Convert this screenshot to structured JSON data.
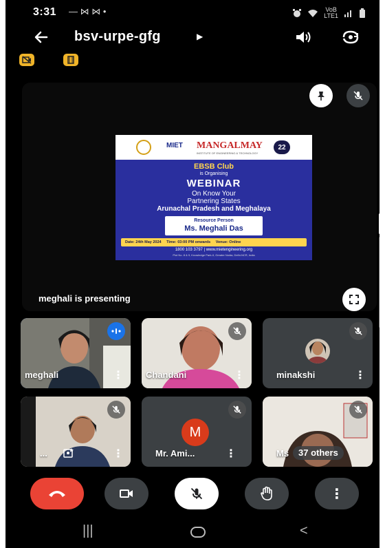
{
  "status_bar": {
    "time": "3:31",
    "notifications": "— ⋈ ⋈ •",
    "network_line1": "VoB",
    "network_line2": "LTE1"
  },
  "top_bar": {
    "meeting_code": "bsv-urpe-gfg",
    "icons": [
      "back-arrow-icon",
      "chevron-right-icon",
      "speaker-icon",
      "switch-camera-icon"
    ]
  },
  "chips": [
    "camera-off-icon",
    "phone-portrait-icon"
  ],
  "presentation": {
    "caption": "meghali is presenting",
    "poster": {
      "org_short": "MIET",
      "org_name": "MANGALMAY",
      "org_sub": "INSTITUTE OF ENGINEERING & TECHNOLOGY",
      "badge": "22",
      "club": "EBSB Club",
      "organising": "is Organising",
      "event": "WEBINAR",
      "line1": "On Know Your",
      "line2": "Partnering States",
      "line3": "Arunachal Pradesh and Meghalaya",
      "resource_label": "Resource Person",
      "resource_name": "Ms. Meghali Das",
      "date": "Date: 24th May 2024",
      "time": "Time: 03:00 PM onwards",
      "venue": "Venue: Online",
      "contact": "1800 103 3797 | www.mietengineering.org",
      "address": "Plot No. 8 & 9, Knowledge Park-II, Greater Noida, Delhi-NCR, India"
    }
  },
  "participants": [
    {
      "name": "meghali",
      "speaking": true
    },
    {
      "name": "Chandani",
      "muted": true
    },
    {
      "name": "minakshi",
      "muted": true
    },
    {
      "name": "...",
      "muted": true
    },
    {
      "name": "Mr. Ami...",
      "initial": "M",
      "avatar_color": "#d93b1b",
      "muted": true
    },
    {
      "name": "Ms",
      "muted": true
    }
  ],
  "others_label": "37 others",
  "colors": {
    "end_call": "#ea4335",
    "control_bg": "#3c4043",
    "speaking_border": "#8ab4f8",
    "chip": "#f0b429",
    "poster_bg": "#2a2f9e"
  }
}
